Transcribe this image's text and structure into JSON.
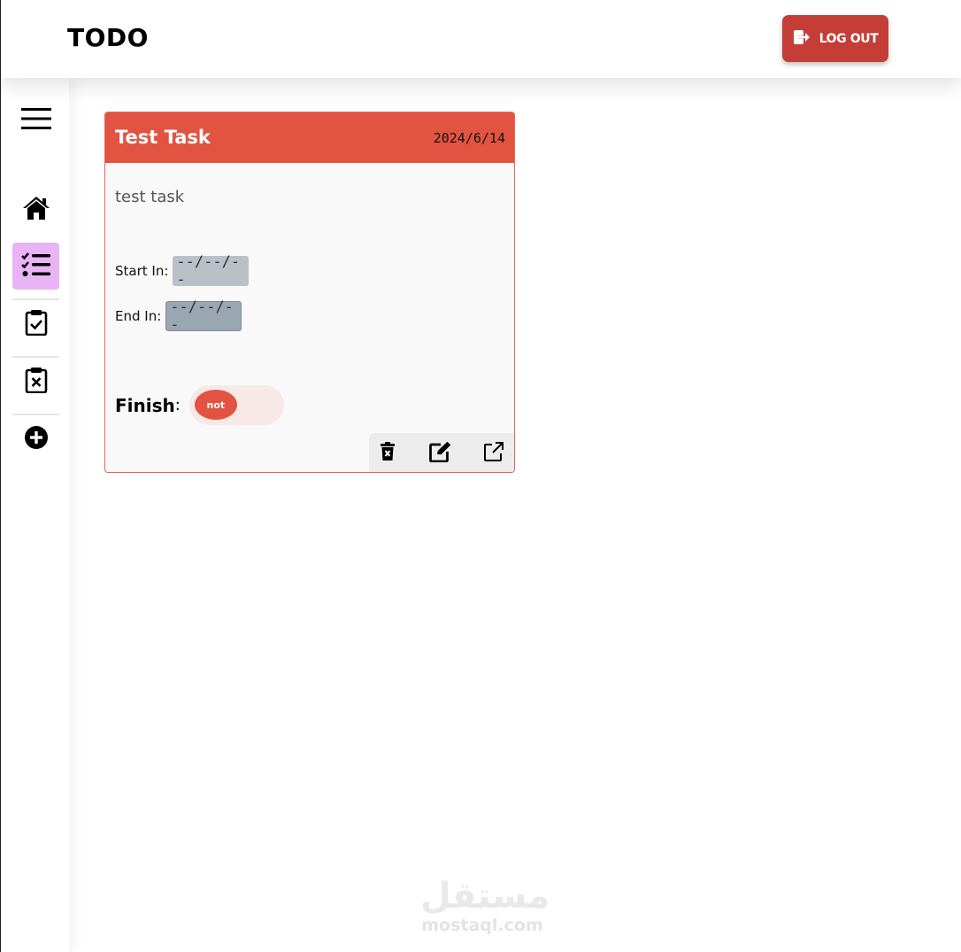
{
  "header": {
    "app_title": "TODO",
    "logout_label": "LOG OUT"
  },
  "sidebar": {
    "items": [
      {
        "icon": "menu-icon",
        "active": false
      },
      {
        "icon": "home-icon",
        "active": false
      },
      {
        "icon": "list-check-icon",
        "active": true
      },
      {
        "icon": "clipboard-check-icon",
        "active": false
      },
      {
        "icon": "clipboard-x-icon",
        "active": false
      },
      {
        "icon": "plus-circle-icon",
        "active": false
      }
    ],
    "active_color": "#e8b4f6"
  },
  "task_card": {
    "title": "Test Task",
    "date": "2024/6/14",
    "description": "test task",
    "start_label": "Start In:",
    "start_value": "--/--/--",
    "end_label": "End In:",
    "end_value": "--/--/--",
    "finish_label": "Finish",
    "finish_colon": ":",
    "finish_state": "not",
    "actions": [
      "trash-x-icon",
      "edit-icon",
      "external-link-icon"
    ],
    "header_color": "#e25341"
  },
  "watermark": {
    "arabic": "مستقل",
    "latin": "mostaql.com"
  },
  "colors": {
    "logout_button": "#c43e37",
    "accent": "#e25341"
  }
}
